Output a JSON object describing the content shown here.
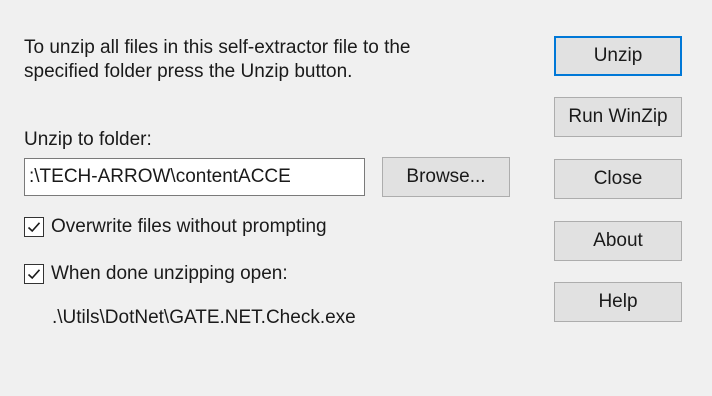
{
  "dialog": {
    "instructions": "To unzip all files in this self-extractor file to the\nspecified folder press the Unzip button.",
    "folder_label": "Unzip to folder:",
    "folder_value": ":\\TECH-ARROW\\contentACCE",
    "browse_label": "Browse...",
    "overwrite_label": "Overwrite files without prompting",
    "overwrite_checked": true,
    "open_label": "When done unzipping open:",
    "open_checked": true,
    "open_path": ".\\Utils\\DotNet\\GATE.NET.Check.exe"
  },
  "buttons": {
    "unzip": "Unzip",
    "run_winzip": "Run WinZip",
    "close": "Close",
    "about": "About",
    "help": "Help"
  },
  "icons": {
    "checkmark": "checkmark-icon"
  },
  "colors": {
    "default_button_border": "#0078d7",
    "background": "#f0f0f0"
  }
}
